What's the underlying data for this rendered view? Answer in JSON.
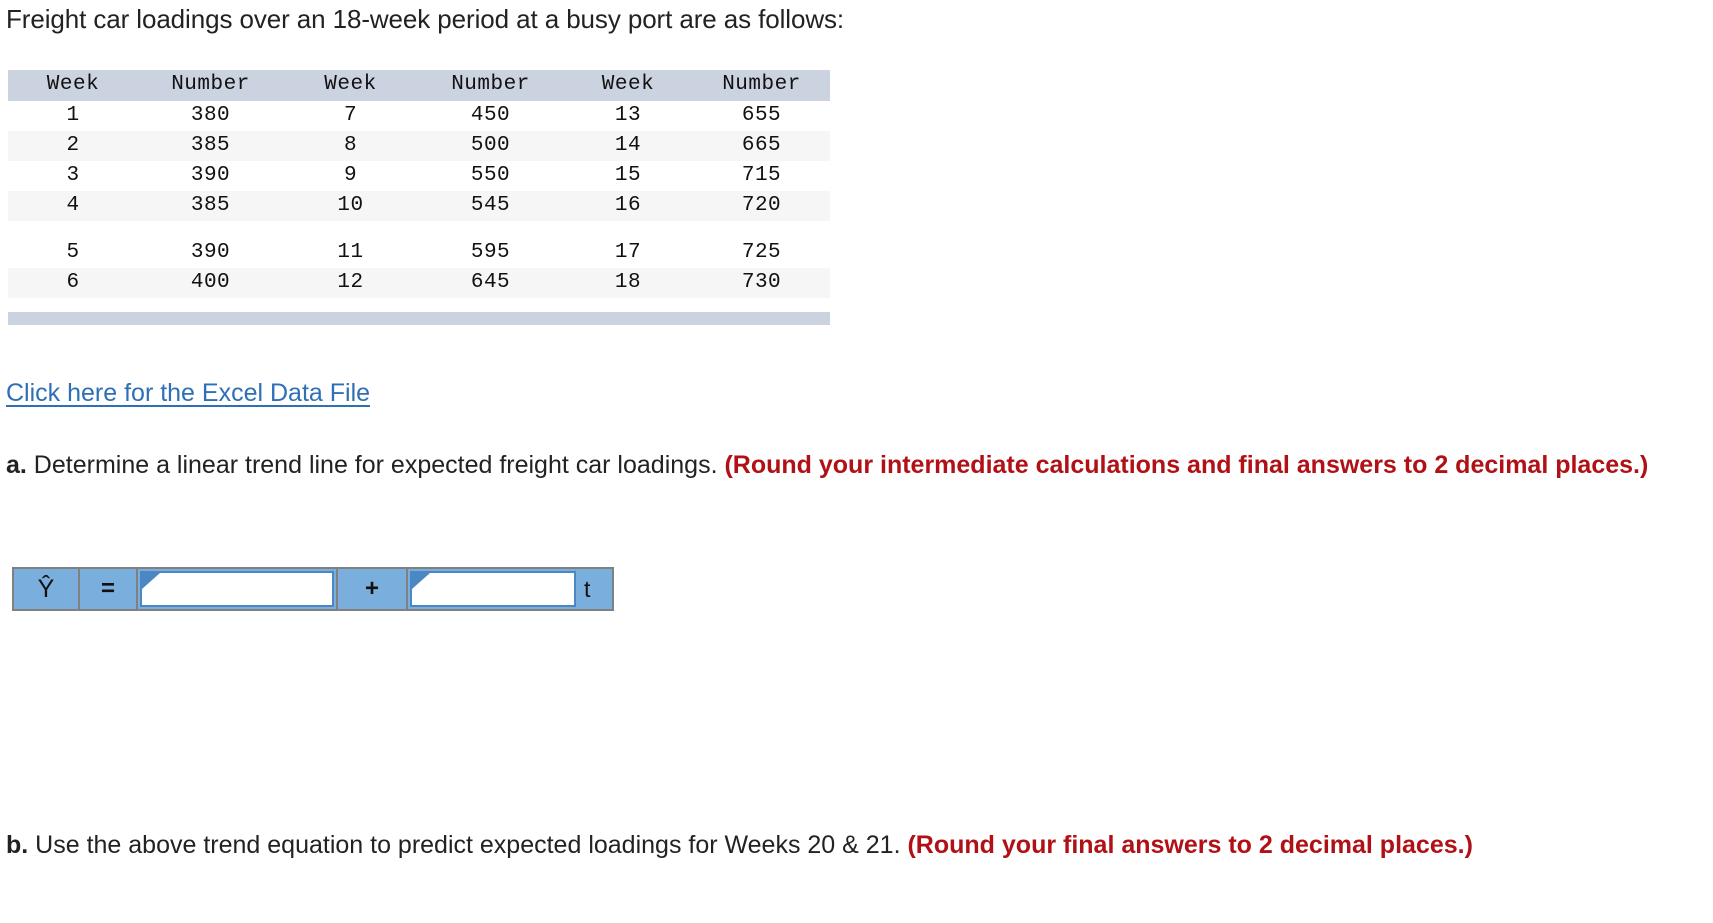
{
  "intro": {
    "text": "Freight car loadings over an 18-week period at a busy port are as follows:"
  },
  "table": {
    "headers": [
      "Week",
      "Number",
      "Week",
      "Number",
      "Week",
      "Number"
    ],
    "rows": [
      [
        "1",
        "380",
        "7",
        "450",
        "13",
        "655"
      ],
      [
        "2",
        "385",
        "8",
        "500",
        "14",
        "665"
      ],
      [
        "3",
        "390",
        "9",
        "550",
        "15",
        "715"
      ],
      [
        "4",
        "385",
        "10",
        "545",
        "16",
        "720"
      ],
      [
        "5",
        "390",
        "11",
        "595",
        "17",
        "725"
      ],
      [
        "6",
        "400",
        "12",
        "645",
        "18",
        "730"
      ]
    ]
  },
  "excel_link": {
    "label": "Click here for the Excel Data File"
  },
  "question_a": {
    "marker": "a.",
    "text": " Determine a linear trend line for expected freight car loadings. ",
    "note": "(Round your intermediate calculations and final answers to 2 decimal places.)"
  },
  "question_b": {
    "marker": "b.",
    "text": " Use the above trend equation to predict expected loadings for Weeks 20 & 21. ",
    "note": "(Round your final answers to 2 decimal places.)"
  },
  "formula": {
    "yhat_label": "Ŷ",
    "equals_label": "=",
    "plus_label": "+",
    "t_label": "t",
    "intercept_value": "",
    "intercept_placeholder": "",
    "slope_value": "",
    "slope_placeholder": ""
  },
  "colors": {
    "header_band": "#ccd3e0",
    "row_stripe": "#f6f6f6",
    "link_blue": "#2f6fb5",
    "note_red": "#b01116",
    "widget_blue": "#79aedd",
    "widget_border": "#808080",
    "input_border": "#4a87c4"
  },
  "chart_data": {
    "type": "table",
    "title": "Freight car loadings over an 18-week period",
    "xlabel": "Week",
    "ylabel": "Number",
    "x": [
      1,
      2,
      3,
      4,
      5,
      6,
      7,
      8,
      9,
      10,
      11,
      12,
      13,
      14,
      15,
      16,
      17,
      18
    ],
    "values": [
      380,
      385,
      390,
      385,
      390,
      400,
      450,
      500,
      550,
      545,
      595,
      645,
      655,
      665,
      715,
      720,
      725,
      730
    ]
  }
}
